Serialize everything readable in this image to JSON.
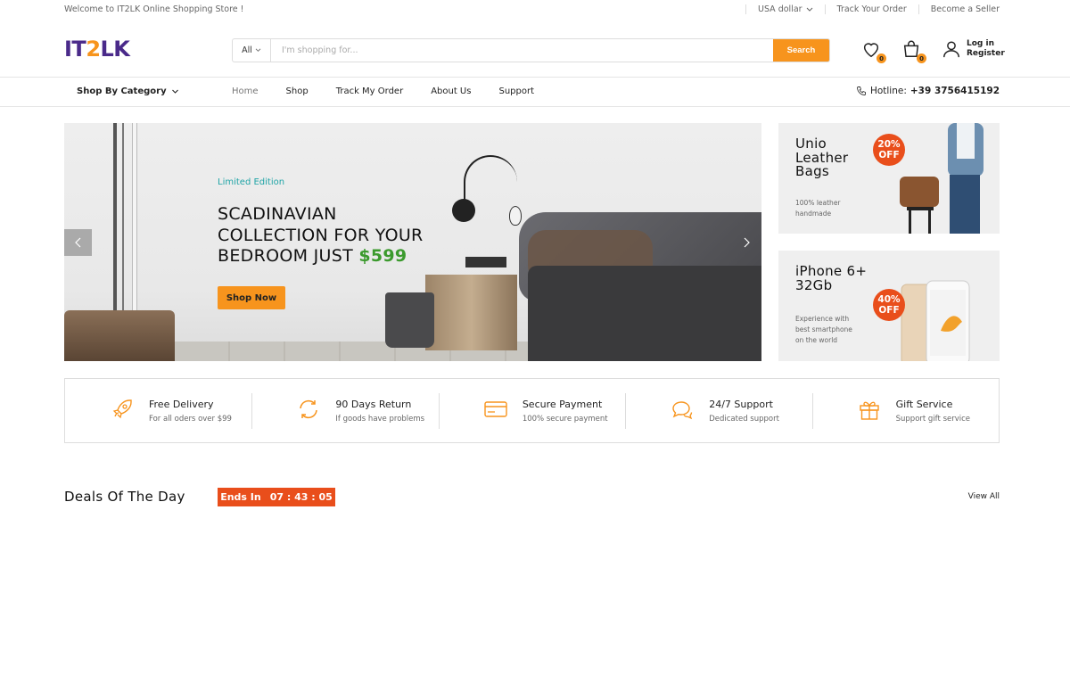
{
  "topbar": {
    "welcome": "Welcome to IT2LK Online Shopping Store !",
    "currency": "USA dollar",
    "track_order": "Track Your Order",
    "become_seller": "Become a Seller"
  },
  "header": {
    "logo_left": "IT",
    "logo_mid": "2",
    "logo_right": "LK",
    "search_category": "All",
    "search_placeholder": "I'm shopping for...",
    "search_button": "Search",
    "wishlist_count": "0",
    "cart_count": "0",
    "login": "Log in",
    "register": "Register"
  },
  "nav": {
    "category": "Shop By Category",
    "links": [
      "Home",
      "Shop",
      "Track My Order",
      "About Us",
      "Support"
    ],
    "hotline_label": "Hotline:",
    "hotline_number": "+39 3756415192"
  },
  "hero": {
    "subtitle": "Limited Edition",
    "title_line1": "SCADINAVIAN",
    "title_line2": "COLLECTION FOR YOUR",
    "title_line3": "BEDROOM JUST",
    "price": "$599",
    "button": "Shop Now"
  },
  "banners": [
    {
      "title_line1": "Unio",
      "title_line2": "Leather",
      "title_line3": "Bags",
      "desc_line1": "100% leather",
      "desc_line2": "handmade",
      "off_pct": "20%",
      "off_label": "OFF"
    },
    {
      "title_line1": "iPhone 6+",
      "title_line2": "32Gb",
      "desc_line1": "Experience with",
      "desc_line2": "best smartphone",
      "desc_line3": "on the world",
      "off_pct": "40%",
      "off_label": "OFF"
    }
  ],
  "features": [
    {
      "icon": "rocket-icon",
      "title": "Free Delivery",
      "desc": "For all oders over $99"
    },
    {
      "icon": "refresh-icon",
      "title": "90 Days Return",
      "desc": "If goods have problems"
    },
    {
      "icon": "credit-card-icon",
      "title": "Secure Payment",
      "desc": "100% secure payment"
    },
    {
      "icon": "chat-icon",
      "title": "24/7 Support",
      "desc": "Dedicated support"
    },
    {
      "icon": "gift-icon",
      "title": "Gift Service",
      "desc": "Support gift service"
    }
  ],
  "deals": {
    "title": "Deals Of The Day",
    "ends_label": "Ends In",
    "countdown": "07 : 43 : 05",
    "view_all": "View All"
  },
  "colors": {
    "accent": "#f7941d",
    "brand": "#4a2a8a",
    "sale": "#e94e1b",
    "teal": "#1fa4a6",
    "price": "#3b9a2d"
  }
}
